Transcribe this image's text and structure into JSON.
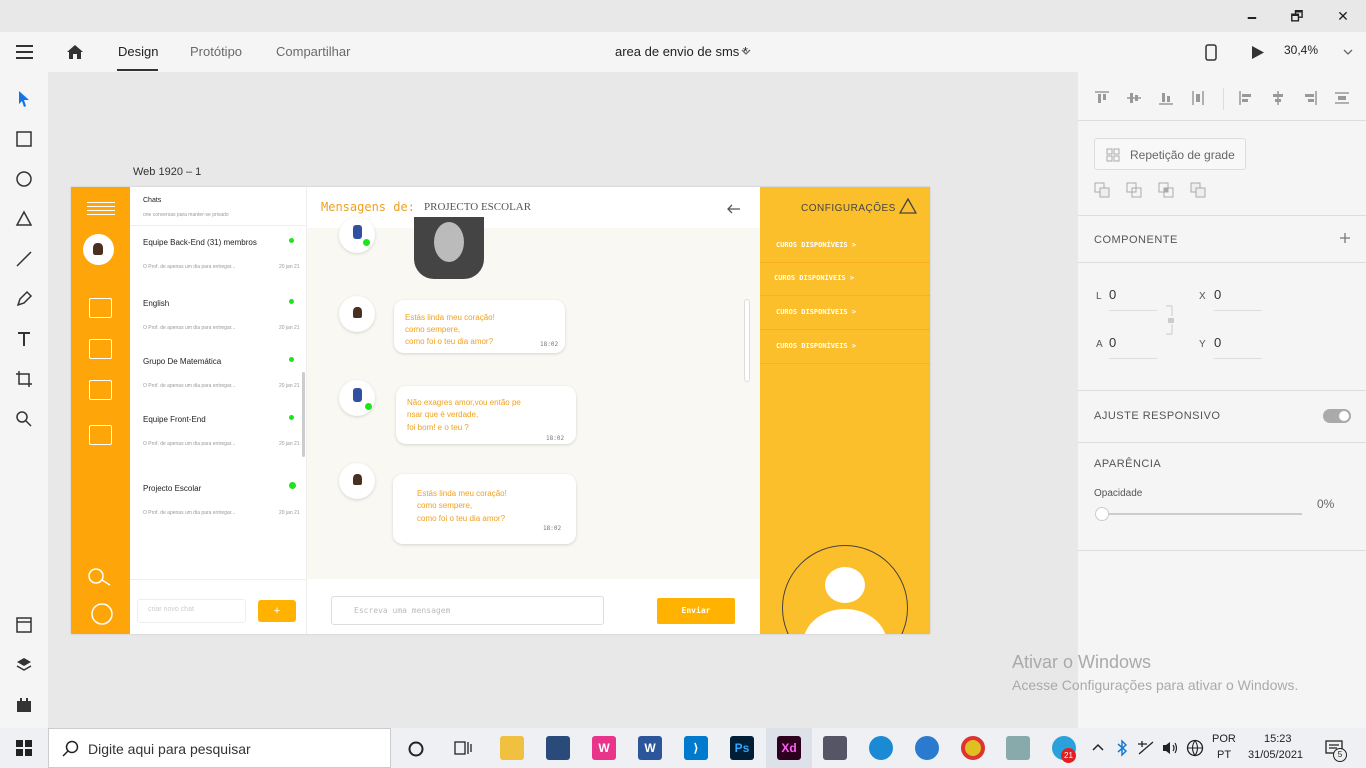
{
  "window": {
    "minimize": "🗕",
    "maximize": "🗗",
    "close": "✕"
  },
  "toolbar": {
    "tabs": [
      "Design",
      "Protótipo",
      "Compartilhar"
    ],
    "doc_title": "area de envio de sms *",
    "zoom": "30,4%"
  },
  "left_tools": [
    "select-icon",
    "rectangle-icon",
    "ellipse-icon",
    "triangle-icon",
    "line-icon",
    "pen-icon",
    "text-icon",
    "artboard-icon",
    "zoom-icon"
  ],
  "left_bottom": [
    "document-assets-icon",
    "layers-icon",
    "plugins-icon"
  ],
  "right_panel": {
    "repeat_grid": "Repetição de grade",
    "component": "COMPONENTE",
    "l_label": "L",
    "l_value": "0",
    "x_label": "X",
    "x_value": "0",
    "a_label": "A",
    "a_value": "0",
    "y_label": "Y",
    "y_value": "0",
    "responsive": "AJUSTE RESPONSIVO",
    "appearance": "APARÊNCIA",
    "opacity_label": "Opacidade",
    "opacity_value": "0%"
  },
  "artboard": {
    "name": "Web 1920 – 1",
    "chats_title": "Chats",
    "chats_subtitle": "one conversas para manter-se privado",
    "chats": [
      {
        "name": "Equipe Back-End (31) membros",
        "sub": "O Prof. de apenas um dia para entregar...",
        "date": "20 jan 21"
      },
      {
        "name": "English",
        "sub": "O Prof. de apenas um dia para entregar...",
        "date": "20 jan 21"
      },
      {
        "name": "Grupo De Matemática",
        "sub": "O Prof. de apenas um dia para entregar...",
        "date": "20 jan 21"
      },
      {
        "name": "Equipe Front-End",
        "sub": "O Prof. de apenas um dia para entregar...",
        "date": "20 jan 21"
      },
      {
        "name": "Projecto Escolar",
        "sub": "O Prof. de apenas um dia para entregar...",
        "date": "20 jan 21"
      }
    ],
    "new_chat_placeholder": "criar novo chat",
    "new_chat_button": "+",
    "header_label": "Mensagens de:",
    "header_chat": "PROJECTO ESCOLAR",
    "messages": [
      {
        "lines": [
          "Estás linda meu coração!",
          "como sempere,",
          "como foi o teu dia amor?"
        ],
        "time": "18:02"
      },
      {
        "lines": [
          "Não exagres amor,vou então pe",
          "nsar que é verdade,",
          "foi bom! e o teu ?"
        ],
        "time": "18:02"
      },
      {
        "lines": [
          "Estás linda meu coração!",
          "como sempere,",
          "como foi o teu dia amor?"
        ],
        "time": "18:02"
      }
    ],
    "message_placeholder": "Escreva uma mensagem",
    "send_button": "Enviar",
    "settings_title": "CONFIGURAÇÕES",
    "courses": [
      "CUROS DISPONÍVEIS >",
      "CUROS DISPONÍVEIS >",
      "CUROS DISPONÍVEIS >",
      "CUROS DISPONÍVEIS >"
    ]
  },
  "watermark": {
    "title": "Ativar o Windows",
    "subtitle": "Acesse Configurações para ativar o Windows."
  },
  "taskbar": {
    "search_placeholder": "Digite aqui para pesquisar",
    "lang1": "POR",
    "lang2": "PT",
    "time": "15:23",
    "date": "31/05/2021",
    "telegram_badge": "21",
    "notification_count": "5",
    "apps": [
      "task-view-icon",
      "file-explorer-icon",
      "mysql-icon",
      "wamp-icon",
      "word-icon",
      "vscode-icon",
      "photoshop-icon",
      "xd-icon",
      "mic-app-icon",
      "edge-icon",
      "globe-app-icon",
      "chrome-icon",
      "monitor-app-icon",
      "telegram-icon"
    ]
  }
}
